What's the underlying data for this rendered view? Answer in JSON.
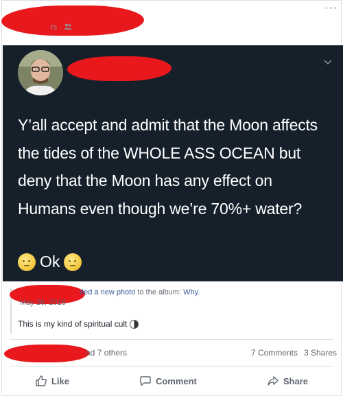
{
  "post": {
    "meta_suffix": "rs ·",
    "more_label": "···"
  },
  "tweet": {
    "text": "Y’all accept and admit that the Moon affects the tides of the WHOLE ASS OCEAN but deny that the Moon has any effect on Humans even though we’re 70%+ water?",
    "ok_text": "Ok"
  },
  "shared": {
    "action_text": "ded a new photo",
    "album_prefix": " to the album: ",
    "album_name": "Why.",
    "date": "May 26, 2018",
    "caption": "This is my kind of spiritual cult"
  },
  "footer": {
    "reactions_text": "nd 7 others",
    "comments_count": "7 Comments",
    "shares_count": "3 Shares",
    "like_label": "Like",
    "comment_label": "Comment",
    "share_label": "Share"
  },
  "colors": {
    "redaction": "#e8181c",
    "tweet_bg": "#15202b",
    "link": "#385898"
  }
}
